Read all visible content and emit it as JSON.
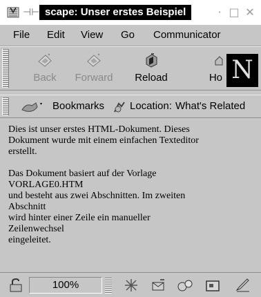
{
  "window": {
    "title": "scape: Unser erstes Beispiel",
    "minimize_glyph": "·",
    "maximize_glyph": "□",
    "close_glyph": "✕",
    "pin_glyph": "⊣⊢"
  },
  "menu": [
    "File",
    "Edit",
    "View",
    "Go",
    "Communicator"
  ],
  "toolbar": {
    "back_label": "Back",
    "forward_label": "Forward",
    "reload_label": "Reload",
    "home_label": "Ho",
    "logo_letter": "N"
  },
  "locationbar": {
    "bookmarks_label": "Bookmarks",
    "location_label": "Location:",
    "whats_related_label": "What's Related"
  },
  "content": {
    "paragraph1": [
      "Dies ist unser erstes HTML-Dokument. Dieses",
      "Dokument wurde mit einem einfachen Texteditor",
      "erstellt."
    ],
    "paragraph2": [
      "Das Dokument basiert auf der Vorlage",
      "VORLAGE0.HTM",
      "und besteht aus zwei Abschnitten. Im zweiten",
      "Abschnitt",
      "wird hinter einer Zeile ein manueller",
      "Zeilenwechsel",
      "eingeleitet."
    ]
  },
  "statusbar": {
    "progress_text": "100%",
    "progress_value": 1.0
  }
}
